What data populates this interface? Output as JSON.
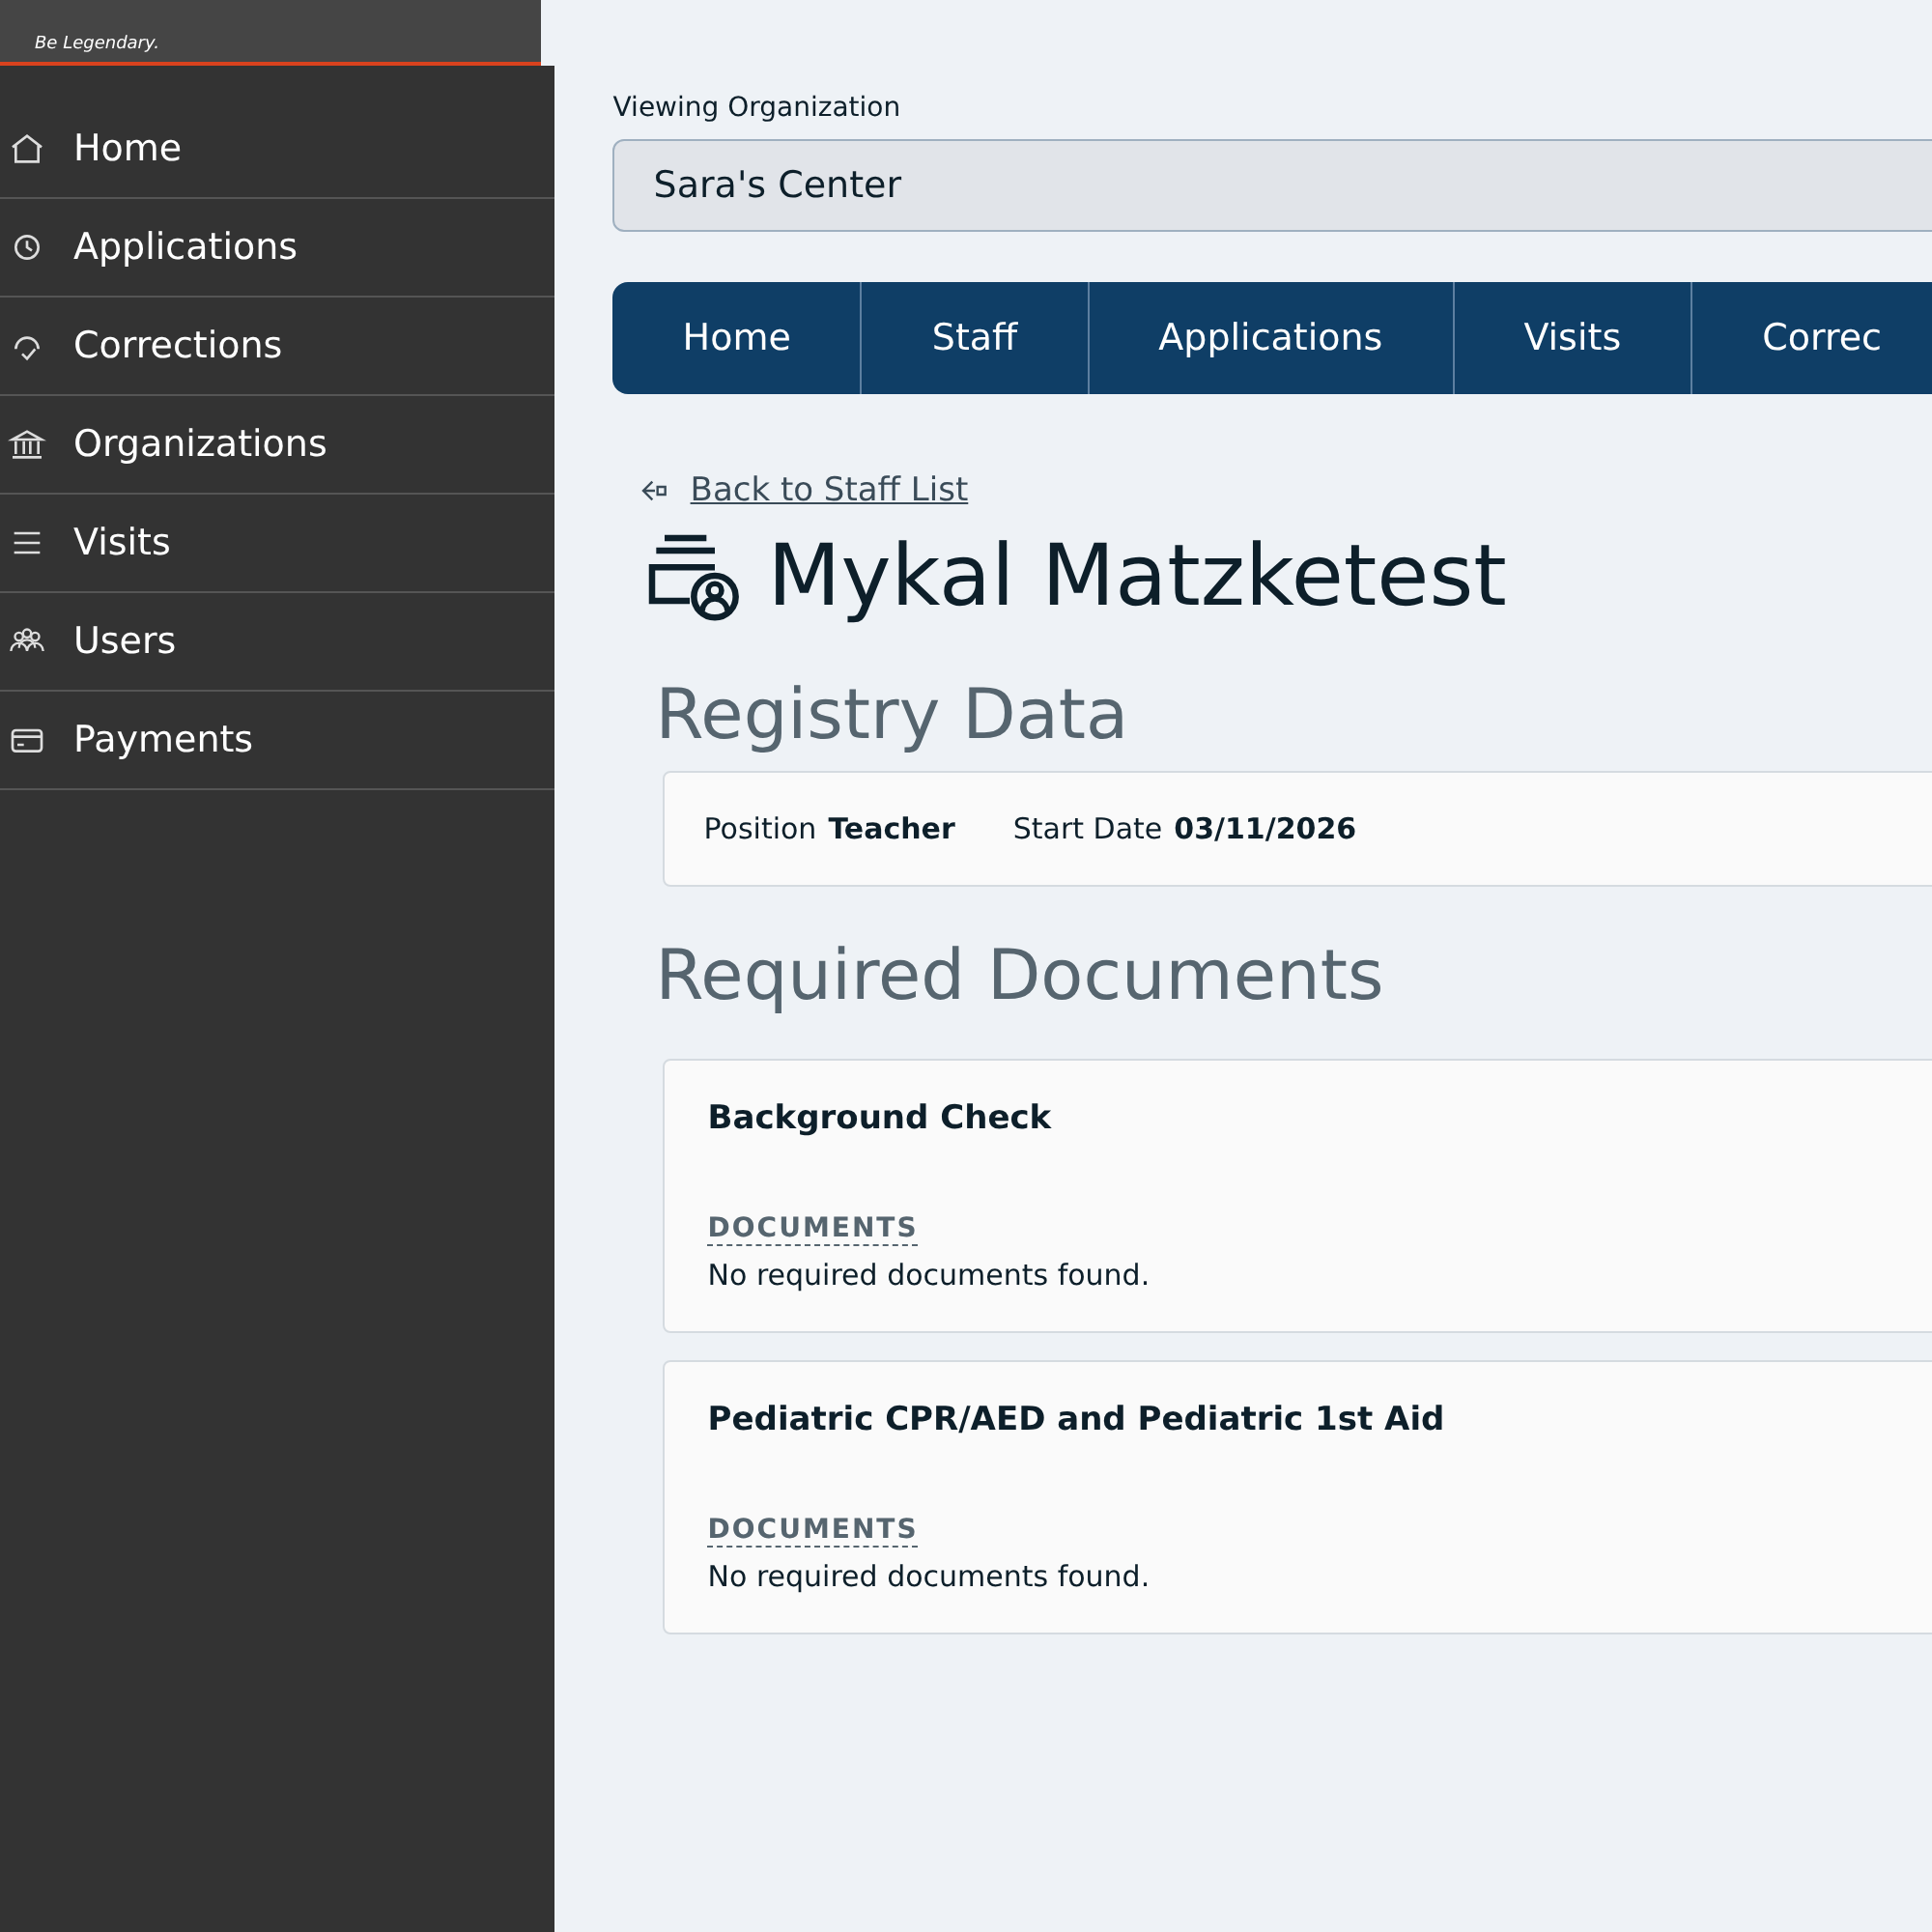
{
  "header": {
    "tagline": "Be Legendary."
  },
  "sidebar": {
    "items": [
      {
        "label": "Home",
        "kind": "home"
      },
      {
        "label": "Applications",
        "kind": "apps"
      },
      {
        "label": "Corrections",
        "kind": "corrections"
      },
      {
        "label": "Organizations",
        "kind": "bank"
      },
      {
        "label": "Visits",
        "kind": "list"
      },
      {
        "label": "Users",
        "kind": "users"
      },
      {
        "label": "Payments",
        "kind": "card"
      }
    ]
  },
  "org": {
    "label": "Viewing Organization",
    "value": "Sara's Center"
  },
  "tabs": [
    "Home",
    "Staff",
    "Applications",
    "Visits",
    "Correc"
  ],
  "back_link": "Back to Staff List",
  "person_name": "Mykal Matzketest",
  "registry": {
    "title": "Registry Data",
    "fields": [
      {
        "label": "Position",
        "value": "Teacher"
      },
      {
        "label": "Start Date",
        "value": "03/11/2026"
      }
    ]
  },
  "required": {
    "title": "Required Documents",
    "items": [
      {
        "title": "Background Check",
        "section": "DOCUMENTS",
        "empty": "No required documents found."
      },
      {
        "title": "Pediatric CPR/AED and Pediatric 1st Aid",
        "section": "DOCUMENTS",
        "empty": "No required documents found."
      }
    ]
  }
}
